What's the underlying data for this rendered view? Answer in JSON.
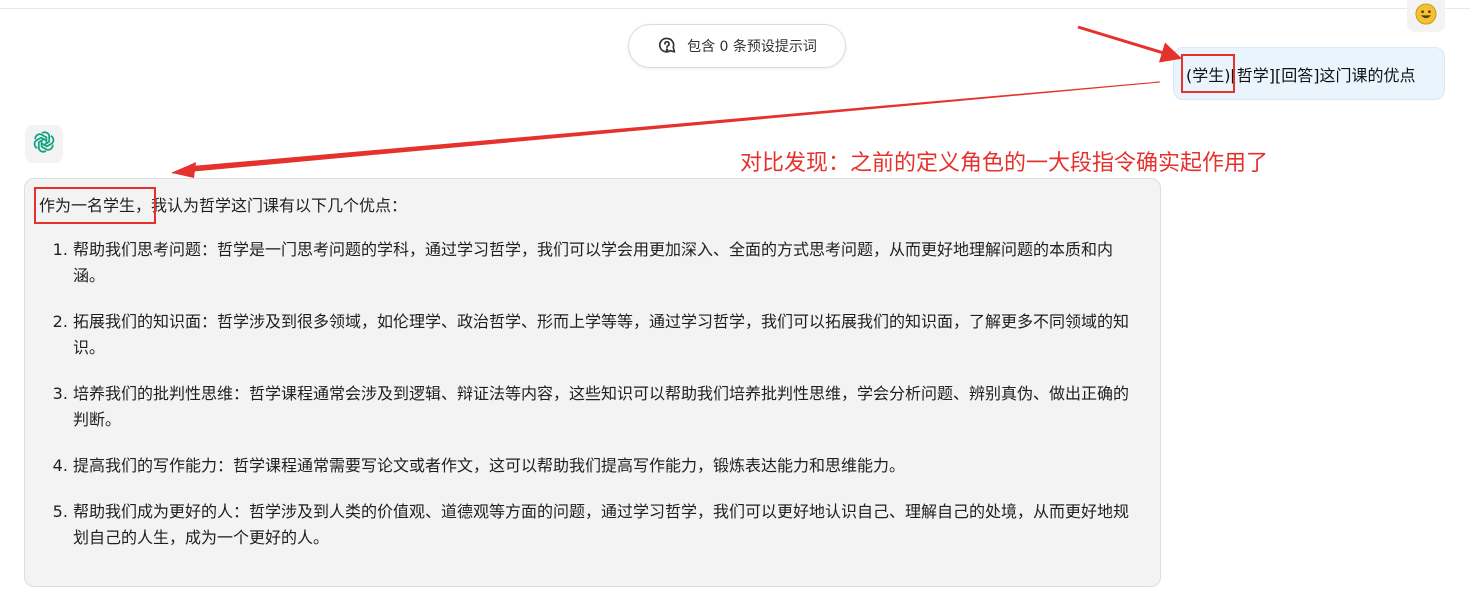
{
  "prompt_button": {
    "label": "包含 0 条预设提示词",
    "icon": "prompt-template-icon"
  },
  "user_avatar": {
    "icon": "smiley-face-icon",
    "color": "#f2c230"
  },
  "user_message": {
    "text": "(学生)[哲学][回答]这门课的优点",
    "highlight": "(学生)",
    "rest": "[哲学][回答]这门课的优点"
  },
  "bot_avatar": {
    "icon": "openai-logo-icon",
    "color": "#10a37f"
  },
  "annotation": {
    "text": "对比发现：之前的定义角色的一大段指令确实起作用了",
    "color": "#e5322d"
  },
  "answer": {
    "intro_highlight": "作为一名学生，",
    "intro_rest": "我认为哲学这门课有以下几个优点：",
    "points": [
      "帮助我们思考问题：哲学是一门思考问题的学科，通过学习哲学，我们可以学会用更加深入、全面的方式思考问题，从而更好地理解问题的本质和内涵。",
      "拓展我们的知识面：哲学涉及到很多领域，如伦理学、政治哲学、形而上学等等，通过学习哲学，我们可以拓展我们的知识面，了解更多不同领域的知识。",
      "培养我们的批判性思维：哲学课程通常会涉及到逻辑、辩证法等内容，这些知识可以帮助我们培养批判性思维，学会分析问题、辨别真伪、做出正确的判断。",
      "提高我们的写作能力：哲学课程通常需要写论文或者作文，这可以帮助我们提高写作能力，锻炼表达能力和思维能力。",
      "帮助我们成为更好的人：哲学涉及到人类的价值观、道德观等方面的问题，通过学习哲学，我们可以更好地认识自己、理解自己的处境，从而更好地规划自己的人生，成为一个更好的人。"
    ]
  }
}
